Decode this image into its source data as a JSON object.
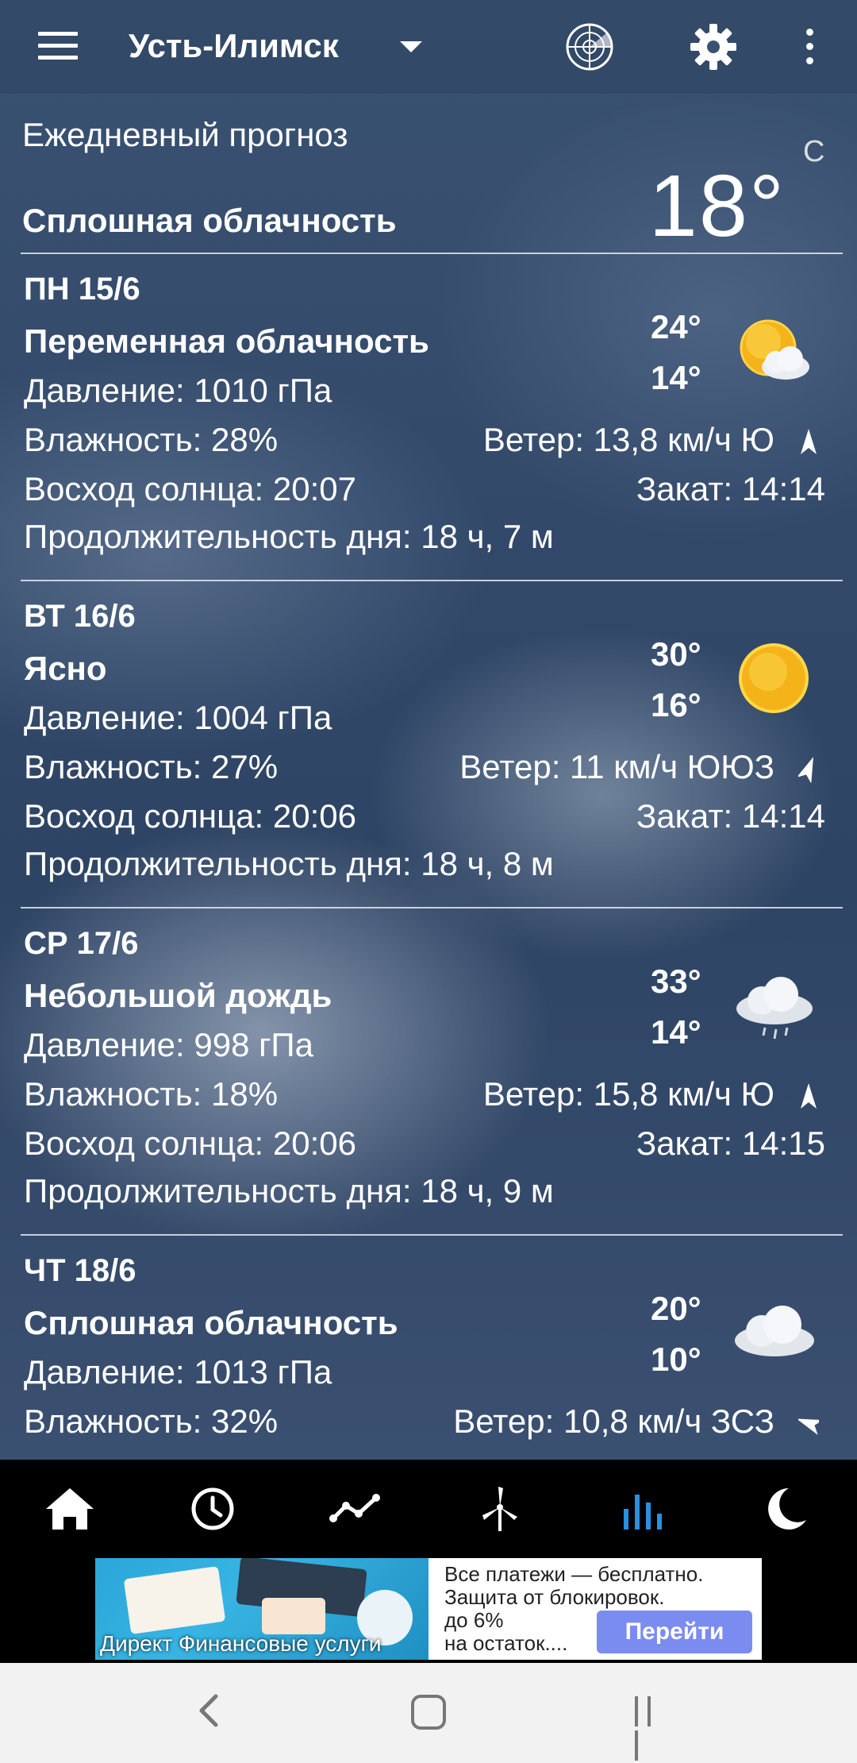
{
  "app": {
    "city": "Усть-Илимск"
  },
  "header": {
    "title": "Ежедневный прогноз",
    "condition": "Сплошная облачность",
    "temperature": "18°",
    "unit": "C"
  },
  "days": [
    {
      "date": "ПН 15/6",
      "condition": "Переменная облачность",
      "pressure": "Давление: 1010 гПа",
      "humidity": "Влажность: 28%",
      "sunrise": "Восход солнца: 20:07",
      "day_length": "Продолжительность дня: 18 ч, 7 м",
      "high": "24°",
      "low": "14°",
      "wind": "Ветер: 13,8 км/ч Ю",
      "sunset": "Закат: 14:14",
      "icon": "partly-cloudy-icon"
    },
    {
      "date": "ВТ 16/6",
      "condition": "Ясно",
      "pressure": "Давление: 1004 гПа",
      "humidity": "Влажность: 27%",
      "sunrise": "Восход солнца: 20:06",
      "day_length": "Продолжительность дня: 18 ч, 8 м",
      "high": "30°",
      "low": "16°",
      "wind": "Ветер: 11 км/ч ЮЮЗ",
      "sunset": "Закат: 14:14",
      "icon": "sun-icon"
    },
    {
      "date": "СР 17/6",
      "condition": "Небольшой дождь",
      "pressure": "Давление: 998 гПа",
      "humidity": "Влажность: 18%",
      "sunrise": "Восход солнца: 20:06",
      "day_length": "Продолжительность дня: 18 ч, 9 м",
      "high": "33°",
      "low": "14°",
      "wind": "Ветер: 15,8 км/ч Ю",
      "sunset": "Закат: 14:15",
      "icon": "light-rain-icon"
    },
    {
      "date": "ЧТ 18/6",
      "condition": "Сплошная облачность",
      "pressure": "Давление: 1013 гПа",
      "humidity": "Влажность: 32%",
      "wind": "Ветер: 10,8 км/ч ЗСЗ",
      "high": "20°",
      "low": "10°",
      "icon": "cloud-icon"
    }
  ],
  "bottom_nav": [
    {
      "icon": "home-icon",
      "active": false
    },
    {
      "icon": "clock-icon",
      "active": false
    },
    {
      "icon": "graph-icon",
      "active": false
    },
    {
      "icon": "wind-turbine-icon",
      "active": false
    },
    {
      "icon": "bar-chart-icon",
      "active": true
    },
    {
      "icon": "moon-icon",
      "active": false
    }
  ],
  "ad": {
    "caption": "Директ  Финансовые услуги",
    "text_lines": [
      "Все платежи — бесплатно.",
      "Защита от блокировок.",
      "до 6%",
      "на остаток...."
    ],
    "button": "Перейти"
  },
  "colors": {
    "accent": "#2a8fe0",
    "ad_button": "#7b8cf0",
    "sun": "#f4b318"
  }
}
